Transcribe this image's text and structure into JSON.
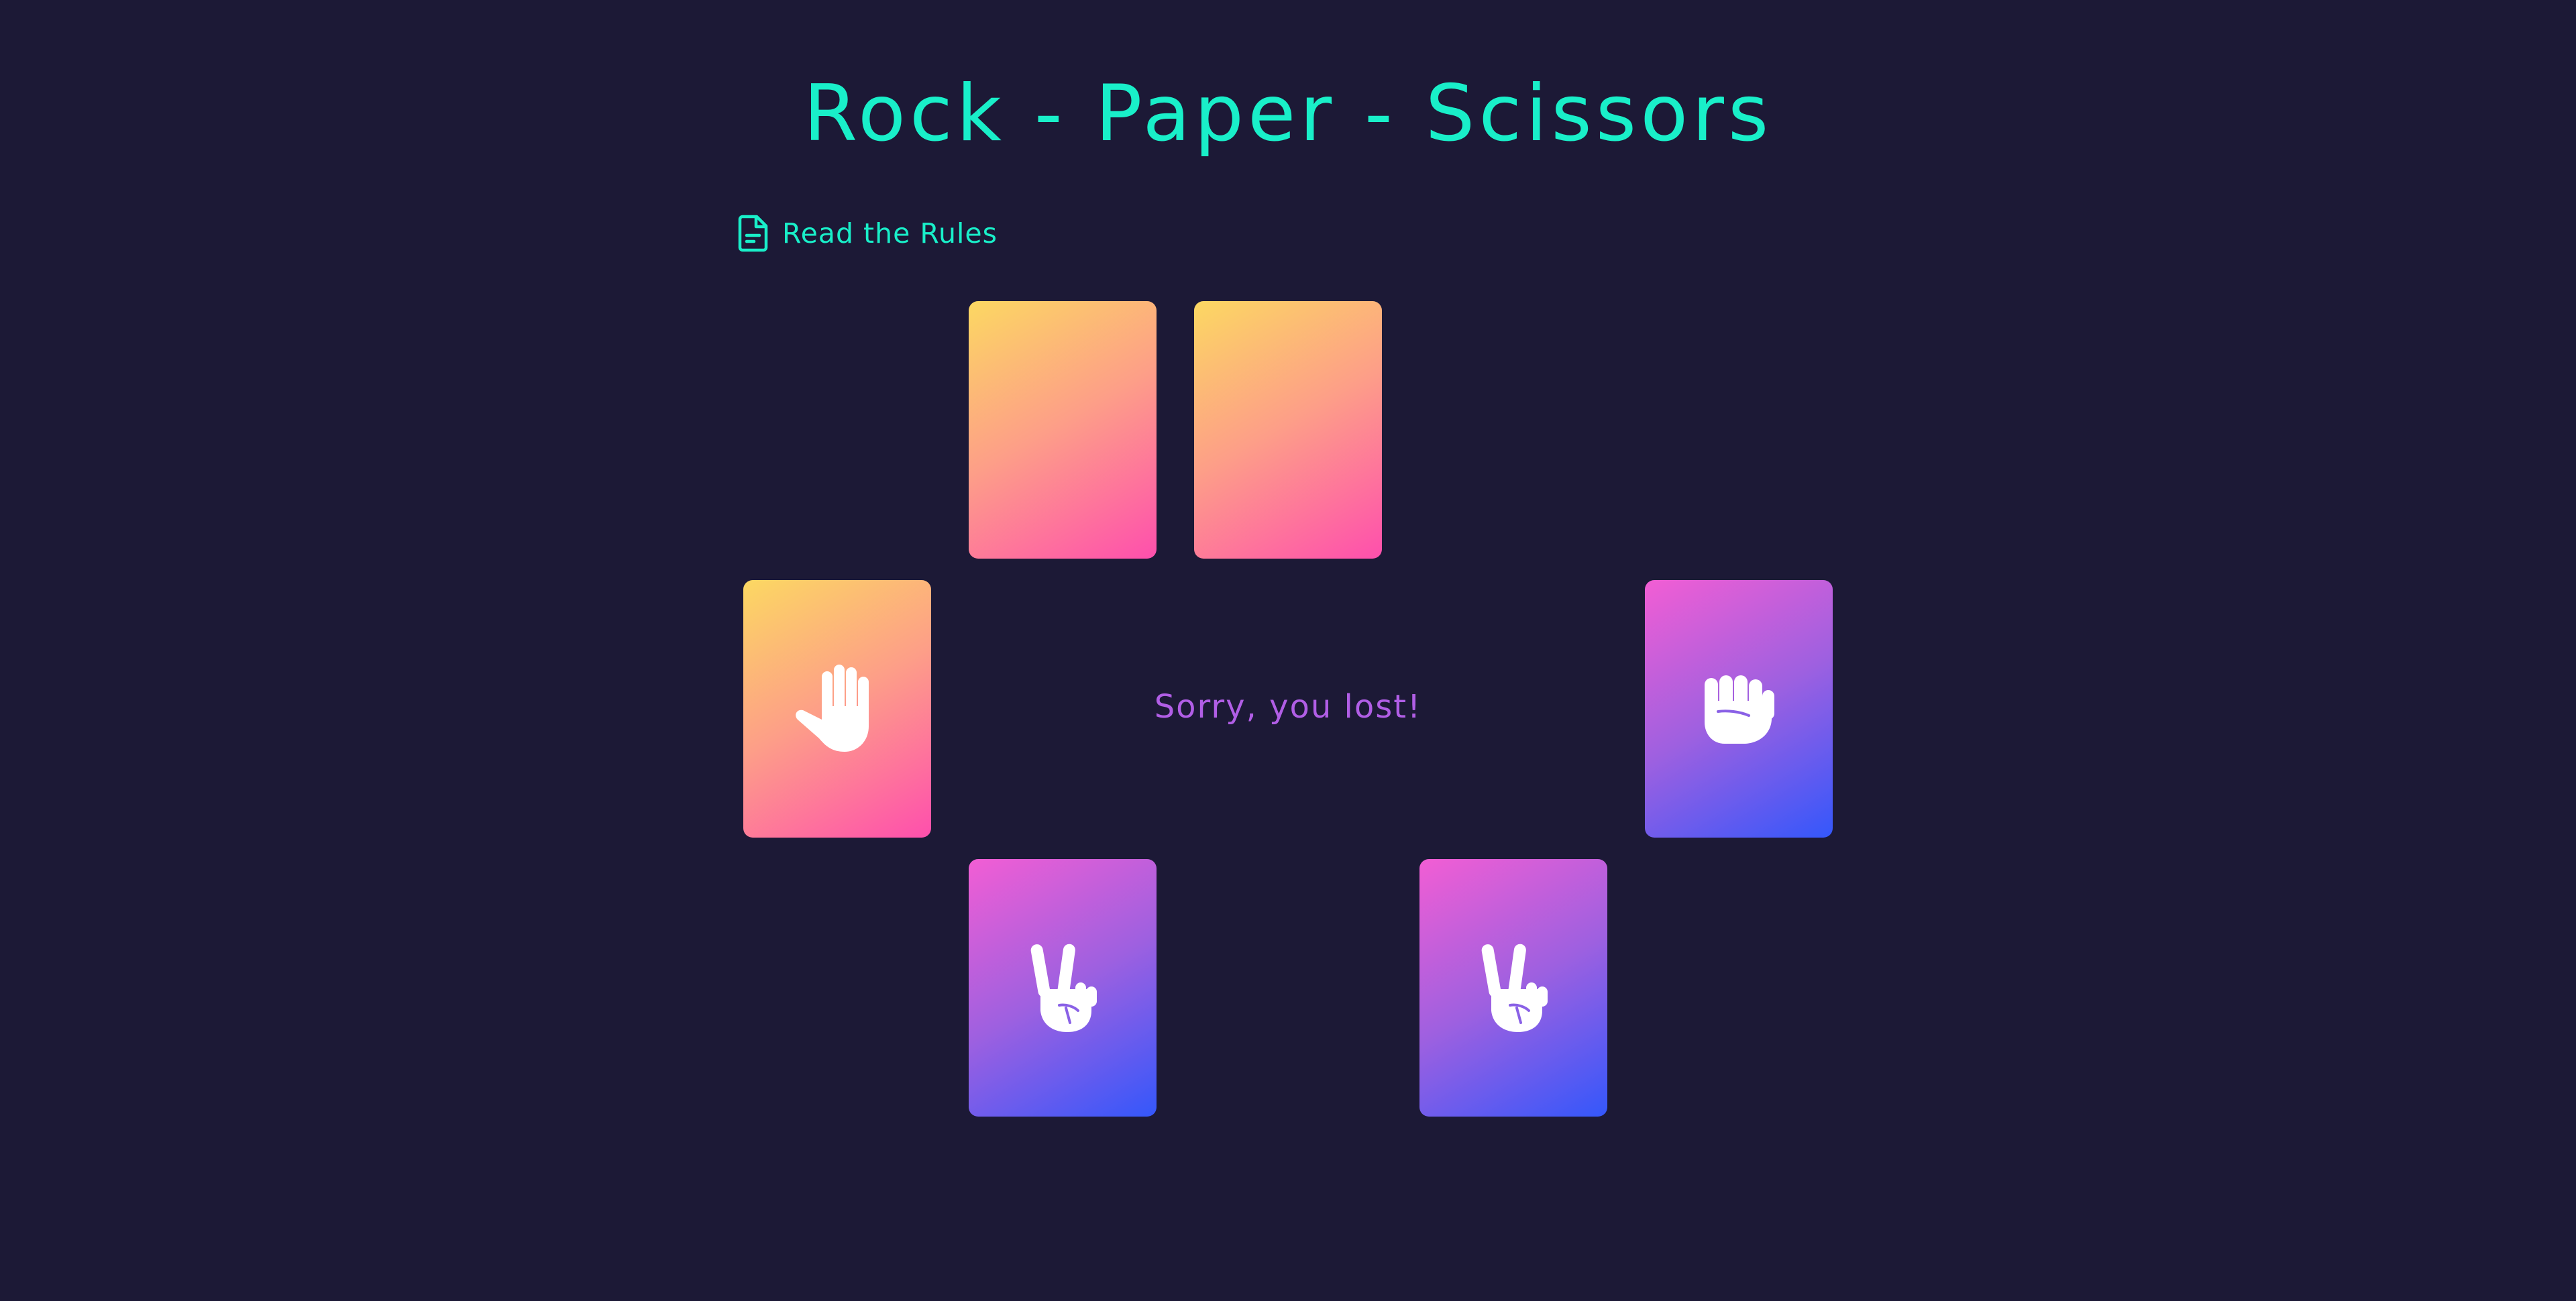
{
  "header": {
    "title": "Rock - Paper - Scissors"
  },
  "rules_link": {
    "label": "Read the Rules",
    "icon": "document-icon"
  },
  "status": {
    "message": "Sorry, you lost!"
  },
  "colors": {
    "background": "#1c1936",
    "accent": "#19efc9",
    "status_text": "#b15ee6",
    "warm_gradient": [
      "#fcd862",
      "#fd9e88",
      "#fe4fad"
    ],
    "cool_gradient": [
      "#f25ed4",
      "#9e60e0",
      "#3457fb"
    ]
  },
  "opponent_hand": [
    {
      "state": "face-down",
      "icon": ""
    },
    {
      "state": "face-down",
      "icon": ""
    }
  ],
  "opponent_played": {
    "state": "face-up",
    "icon": "open-hand-paper-icon"
  },
  "player_played": {
    "state": "face-up",
    "icon": "fist-rock-icon"
  },
  "player_hand": [
    {
      "state": "face-up",
      "icon": "peace-hand-scissors-icon"
    },
    {
      "state": "face-up",
      "icon": "peace-hand-scissors-icon"
    }
  ]
}
